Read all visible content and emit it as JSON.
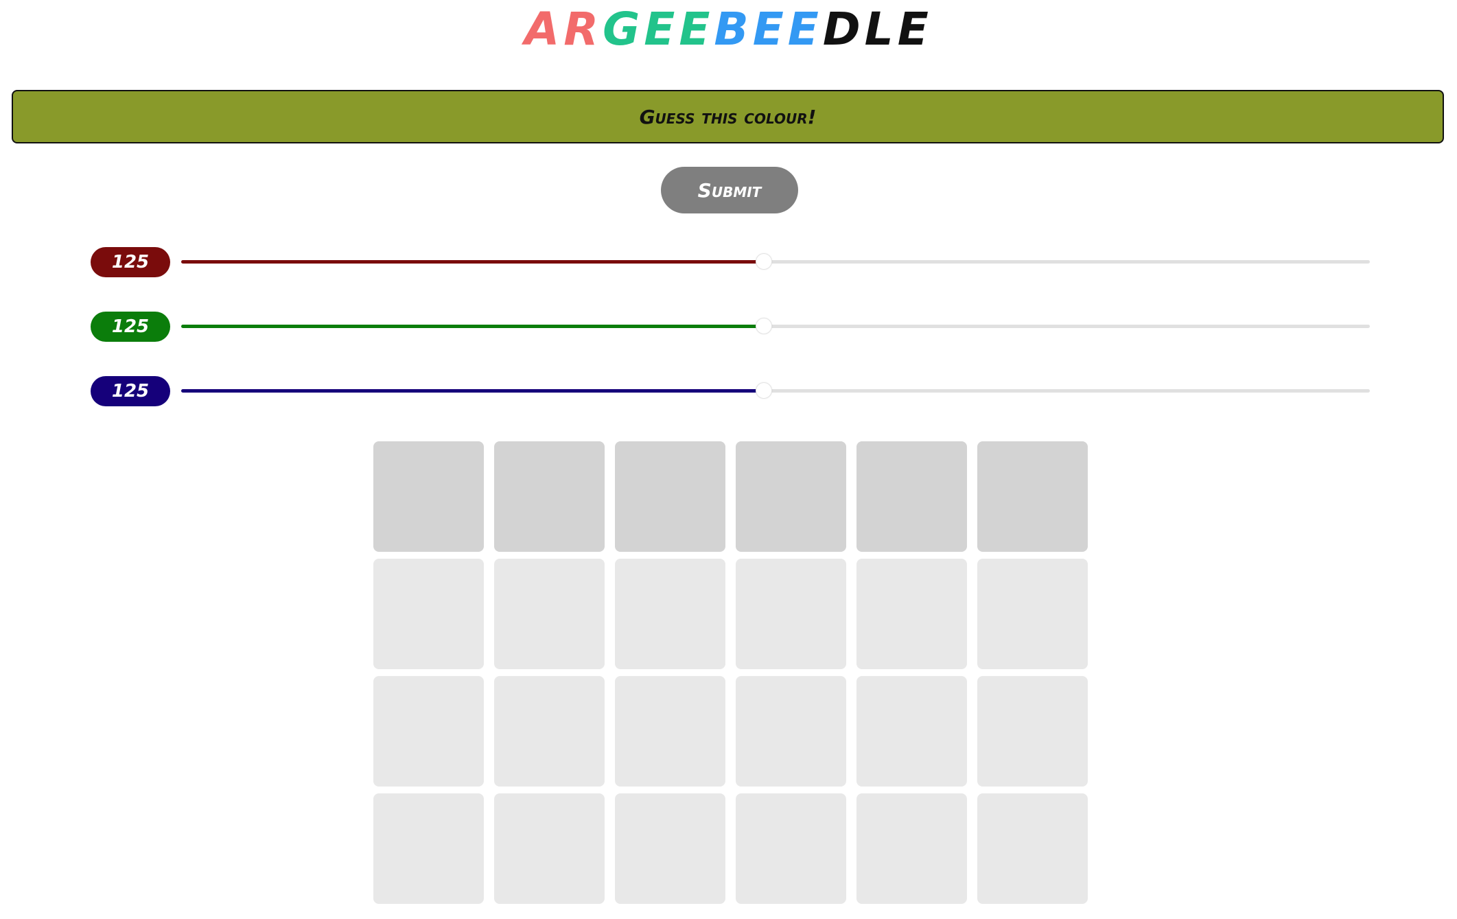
{
  "title": {
    "segments": [
      {
        "text": "AR",
        "color": "#f26b6b"
      },
      {
        "text": "GEE",
        "color": "#22c38b"
      },
      {
        "text": "BEE",
        "color": "#3399f3"
      },
      {
        "text": "DLE",
        "color": "#111111"
      }
    ]
  },
  "target": {
    "prompt": "Guess this colour!",
    "color": "#899a2a"
  },
  "submit_label": "Submit",
  "sliders": [
    {
      "channel": "red",
      "value": "125",
      "max": 255,
      "color": "#7a0c0c"
    },
    {
      "channel": "green",
      "value": "125",
      "max": 255,
      "color": "#0b7d0b"
    },
    {
      "channel": "blue",
      "value": "125",
      "max": 255,
      "color": "#15007a"
    }
  ],
  "board": {
    "rows": 4,
    "columns": 6,
    "active_row": 0,
    "active_color": "#d3d3d3",
    "empty_color": "#e8e8e8"
  }
}
